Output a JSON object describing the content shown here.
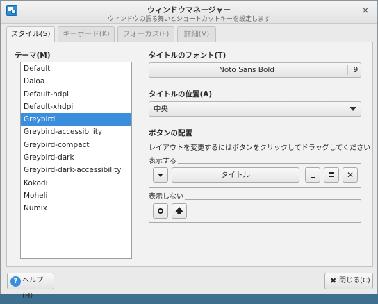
{
  "window": {
    "title": "ウィンドウマネージャー",
    "subtitle": "ウィンドウの振る舞いとショートカットキーを設定します",
    "close_glyph": "×"
  },
  "tabs": [
    {
      "label": "スタイル(S)",
      "active": true
    },
    {
      "label": "キーボード(K)",
      "active": false
    },
    {
      "label": "フォーカス(F)",
      "active": false
    },
    {
      "label": "詳細(V)",
      "active": false
    }
  ],
  "theme": {
    "label": "テーマ(M)",
    "items": [
      "Default",
      "Daloa",
      "Default-hdpi",
      "Default-xhdpi",
      "Greybird",
      "Greybird-accessibility",
      "Greybird-compact",
      "Greybird-dark",
      "Greybird-dark-accessibility",
      "Kokodi",
      "Moheli",
      "Numix"
    ],
    "selected": "Greybird"
  },
  "title_font": {
    "label": "タイトルのフォント(T)",
    "name": "Noto Sans Bold",
    "size": "9"
  },
  "title_position": {
    "label": "タイトルの位置(A)",
    "value": "中央"
  },
  "button_layout": {
    "label": "ボタンの配置",
    "help": "レイアウトを変更するにはボタンをクリックしてドラッグしてください",
    "shown_label": "表示する",
    "hidden_label": "表示しない",
    "title_button": "タイトル",
    "close_glyph": "✕",
    "shade_glyph": "🡅"
  },
  "footer": {
    "help_label": "ヘルプ(H)",
    "help_glyph": "?",
    "close_label": "閉じる(C)",
    "close_glyph": "✖"
  },
  "colors": {
    "selection": "#3b8edb",
    "desktop": "#3f6f8e"
  }
}
